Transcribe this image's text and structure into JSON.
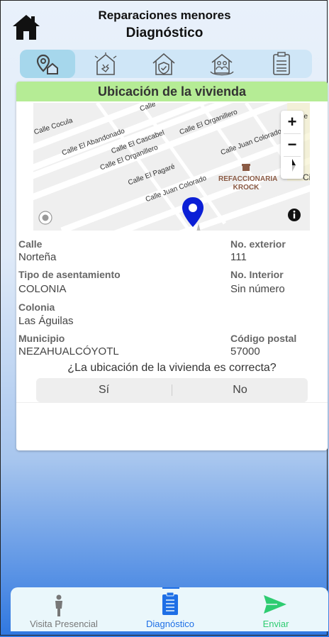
{
  "header": {
    "title": "Reparaciones menores",
    "subtitle": "Diagnóstico",
    "home_icon": "home-icon"
  },
  "tabs": [
    {
      "icon": "location-home-icon",
      "active": true
    },
    {
      "icon": "damaged-house-icon",
      "active": false
    },
    {
      "icon": "house-shield-icon",
      "active": false
    },
    {
      "icon": "family-house-icon",
      "active": false
    },
    {
      "icon": "document-list-icon",
      "active": false
    }
  ],
  "card": {
    "title": "Ubicación de la vivienda"
  },
  "map": {
    "streets": [
      "Calle Cocula",
      "Calle El Abandonado",
      "Calle El Cascabel",
      "Calle El Organillero",
      "Calle El Pagaré",
      "Calle Juan Colorado",
      "Calle El Organillero",
      "Calle Juan Colorado",
      "Calle"
    ],
    "poi_name": "REFACCIONARIA KROCK",
    "zoom_in": "+",
    "zoom_out": "−",
    "right_edge_text": "Ci",
    "right_edge_text2": "pe",
    "colors": {
      "pin": "#0b1fd6",
      "road": "#ffffff",
      "land": "#efefef"
    }
  },
  "fields": {
    "calle_label": "Calle",
    "calle_value": "Norteña",
    "no_exterior_label": "No. exterior",
    "no_exterior_value": "111",
    "tipo_label": "Tipo de asentamiento",
    "tipo_value": "COLONIA",
    "no_interior_label": "No. Interior",
    "no_interior_value": "Sin número",
    "colonia_label": "Colonia",
    "colonia_value": "Las Águilas",
    "municipio_label": "Municipio",
    "municipio_value": "NEZAHUALCÓYOTL",
    "cp_label": "Código postal",
    "cp_value": "57000"
  },
  "question": {
    "text": "¿La ubicación de la vivienda es correcta?",
    "yes": "Sí",
    "no": "No"
  },
  "bottom_nav": {
    "items": [
      {
        "label": "Visita Presencial",
        "icon": "person-icon",
        "color": "#777777"
      },
      {
        "label": "Diagnóstico",
        "icon": "clipboard-icon",
        "color": "#1e6fe6",
        "active": true
      },
      {
        "label": "Enviar",
        "icon": "send-icon",
        "color": "#2ecc71"
      }
    ]
  }
}
